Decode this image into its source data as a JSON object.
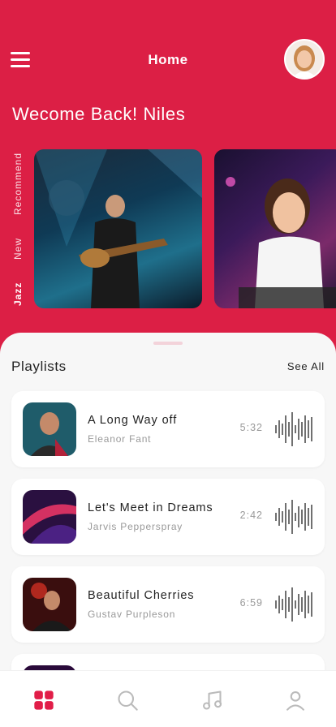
{
  "header": {
    "title": "Home",
    "welcome": "Wecome Back! Niles"
  },
  "vertical_tabs": [
    "Recommend",
    "New",
    "Jazz"
  ],
  "playlists": {
    "title": "Playlists",
    "see_all": "See All",
    "items": [
      {
        "song": "A Long Way off",
        "artist": "Eleanor Fant",
        "duration": "5:32"
      },
      {
        "song": "Let's Meet in Dreams",
        "artist": "Jarvis Pepperspray",
        "duration": "2:42"
      },
      {
        "song": "Beautiful Cherries",
        "artist": "Gustav Purpleson",
        "duration": "6:59"
      }
    ]
  },
  "bottom_nav": {
    "items": [
      "home-grid-icon",
      "search-icon",
      "music-note-icon",
      "profile-icon"
    ]
  },
  "colors": {
    "accent": "#dc1f45",
    "background_light": "#f7f7f7"
  }
}
